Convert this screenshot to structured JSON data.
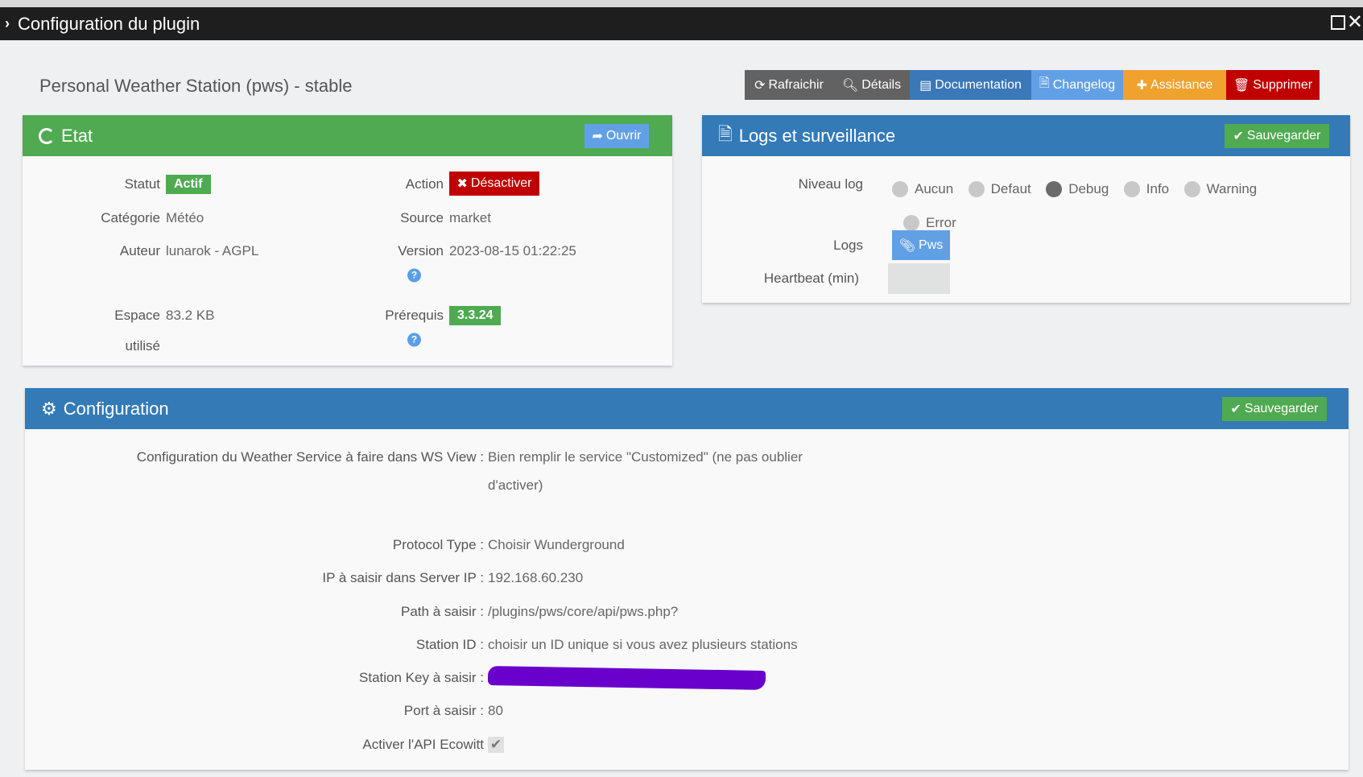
{
  "window": {
    "title": "Configuration du plugin"
  },
  "page": {
    "subtitle": "Personal Weather Station (pws) - stable"
  },
  "toolbar": {
    "refresh": "Rafraichir",
    "details": "Détails",
    "documentation": "Documentation",
    "changelog": "Changelog",
    "assistance": "Assistance",
    "delete": "Supprimer"
  },
  "etat": {
    "title": "Etat",
    "open": "Ouvrir",
    "statut_label": "Statut",
    "statut_value": "Actif",
    "action_label": "Action",
    "action_button": "Désactiver",
    "categorie_label": "Catégorie",
    "categorie_value": "Météo",
    "source_label": "Source",
    "source_value": "market",
    "auteur_label": "Auteur",
    "auteur_value": "lunarok - AGPL",
    "version_label": "Version",
    "version_value": "2023-08-15 01:22:25",
    "espace_label1": "Espace",
    "espace_label2": "utilisé",
    "espace_value": "83.2 KB",
    "prerequis_label": "Prérequis",
    "prerequis_value": "3.3.24"
  },
  "logs": {
    "title": "Logs et surveillance",
    "save": "Sauvegarder",
    "niveau_label": "Niveau log",
    "levels": [
      "Aucun",
      "Defaut",
      "Debug",
      "Info",
      "Warning",
      "Error"
    ],
    "selected": "Debug",
    "logs_label": "Logs",
    "logs_button": "Pws",
    "heartbeat_label": "Heartbeat (min)",
    "heartbeat_value": ""
  },
  "config": {
    "title": "Configuration",
    "save": "Sauvegarder",
    "ws_label": "Configuration du Weather Service à faire dans WS View :",
    "ws_value1": "Bien remplir le service \"Customized\" (ne pas oublier",
    "ws_value2": "d'activer)",
    "protocol_label": "Protocol Type :",
    "protocol_value": "Choisir Wunderground",
    "ip_label": "IP à saisir dans Server IP :",
    "ip_value": "192.168.60.230",
    "path_label": "Path à saisir :",
    "path_value": "/plugins/pws/core/api/pws.php?",
    "station_id_label": "Station ID :",
    "station_id_value": "choisir un ID unique si vous avez plusieurs stations",
    "station_key_label": "Station Key à saisir :",
    "port_label": "Port à saisir :",
    "port_value": "80",
    "ecowitt_label": "Activer l'API Ecowitt"
  },
  "colors": {
    "green": "#4faa51",
    "blue": "#337ab7",
    "red": "#c00000",
    "orange": "#f0a22e",
    "lightblue": "#62a0e6",
    "grey": "#626262",
    "redaction": "#6a00cc"
  }
}
